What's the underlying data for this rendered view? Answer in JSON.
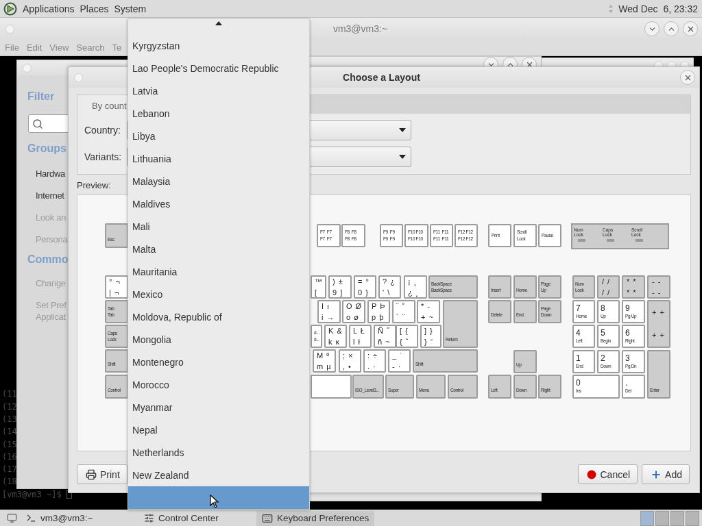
{
  "top_panel": {
    "menus": [
      "Applications",
      "Places",
      "System"
    ],
    "clock": "Wed Dec  6, 23:32"
  },
  "terminal": {
    "title": "vm3@vm3:~",
    "menus": [
      "File",
      "Edit",
      "View",
      "Search",
      "Te"
    ],
    "lines": [
      "(11",
      "(12",
      "(13",
      "(14",
      "(15",
      "(16",
      "(17",
      "(18"
    ],
    "prompt": "[vm3@vm3 ~]$"
  },
  "control_center": {
    "filter_heading": "Filter",
    "groups_heading": "Groups",
    "groups": [
      "Hardwa",
      "Internet",
      "Look an",
      "Persona"
    ],
    "common_heading": "Commo",
    "common": [
      "Change",
      "Set Pref\nApplicat"
    ]
  },
  "dialog": {
    "title": "Choose a Layout",
    "tab": {
      "label": "By count",
      "selected": true
    },
    "country_label": "Country:",
    "variants_label": "Variants:",
    "preview_label": "Preview:",
    "buttons": [
      {
        "kind": "print",
        "label": "Print"
      },
      {
        "kind": "cancel",
        "label": "Cancel"
      },
      {
        "kind": "add",
        "label": "Add"
      }
    ]
  },
  "keyboard": {
    "indicators": [
      {
        "label": "Num\nLock",
        "on": false
      },
      {
        "label": "Caps\nLock",
        "on": false
      },
      {
        "label": "Scroll\nLock",
        "on": false
      }
    ],
    "keys": [
      {
        "kind": "mod",
        "legend": "Esc"
      },
      {
        "kind": "fkey",
        "legend": "F7  F7\nF7  F7"
      },
      {
        "kind": "fkey",
        "legend": "F8  F8\nF8  F8"
      },
      {
        "kind": "fkey",
        "legend": "F9  F9\nF9  F9"
      },
      {
        "kind": "fkey",
        "legend": "F10 F10\nF10 F10"
      },
      {
        "kind": "fkey",
        "legend": "F11  F11\nF11  F11"
      },
      {
        "kind": "fkey",
        "legend": "F12 F12\nF12 F12"
      },
      {
        "kind": "fkey",
        "legend": "Print"
      },
      {
        "kind": "fkey",
        "legend": "Scroll\nLock"
      },
      {
        "kind": "fkey",
        "legend": "Pause"
      },
      {
        "kind": "char",
        "legend": "°  ¬\n|  ¬"
      },
      {
        "kind": "char",
        "legend": "™\n["
      },
      {
        "kind": "char",
        "legend": ")  ±\n9  ]"
      },
      {
        "kind": "char",
        "legend": "=  °\n0  }"
      },
      {
        "kind": "char",
        "legend": "?  ¿\n'  \\"
      },
      {
        "kind": "char",
        "legend": "¡  ¸\n¿  ˛"
      },
      {
        "kind": "mod",
        "legend": "BackSpace\nBackSpace"
      },
      {
        "kind": "mod",
        "legend": "Insert"
      },
      {
        "kind": "mod",
        "legend": "Home"
      },
      {
        "kind": "mod",
        "legend": "Page\nUp"
      },
      {
        "kind": "mod",
        "legend": "Num\nLock"
      },
      {
        "kind": "charmod",
        "legend": "/  /\n/  /"
      },
      {
        "kind": "charmod",
        "legend": "*  *\n*  *"
      },
      {
        "kind": "charmod",
        "legend": "-  -\n-  -"
      },
      {
        "kind": "mod",
        "legend": "Tab\nTab"
      },
      {
        "kind": "char",
        "legend": "I  ı\ni  →"
      },
      {
        "kind": "char",
        "legend": "O  Ø\no  ø"
      },
      {
        "kind": "char",
        "legend": "P  Þ\np  þ"
      },
      {
        "kind": "char",
        "legend": "¨  ˚\n´  ¨"
      },
      {
        "kind": "char",
        "legend": "*  -\n+  ~"
      },
      {
        "kind": "mod",
        "legend": "Return"
      },
      {
        "kind": "mod",
        "legend": "Delete"
      },
      {
        "kind": "mod",
        "legend": "End"
      },
      {
        "kind": "mod",
        "legend": "Page\nDown"
      },
      {
        "kind": "num",
        "legend": "7",
        "sub": "Home"
      },
      {
        "kind": "num",
        "legend": "8",
        "sub": "Up"
      },
      {
        "kind": "num",
        "legend": "9",
        "sub": "Pg Up"
      },
      {
        "kind": "charmod",
        "legend": "+  +\n\n+  +"
      },
      {
        "kind": "mod",
        "legend": "Caps\nLock"
      },
      {
        "kind": "fkey",
        "legend": "d...\nd..."
      },
      {
        "kind": "char",
        "legend": "K  &\nk  ĸ"
      },
      {
        "kind": "char",
        "legend": "L  Ł\nl  ł"
      },
      {
        "kind": "char",
        "legend": "Ñ  ˝\nñ  ~"
      },
      {
        "kind": "char",
        "legend": "[  {\n{  ˆ"
      },
      {
        "kind": "char",
        "legend": "]  }\n}  ˘"
      },
      {
        "kind": "num",
        "legend": "4",
        "sub": "Left"
      },
      {
        "kind": "num",
        "legend": "5",
        "sub": "Begin"
      },
      {
        "kind": "num",
        "legend": "6",
        "sub": "Right"
      },
      {
        "kind": "mod",
        "legend": "Shift"
      },
      {
        "kind": "char",
        "legend": "M  º\nm  µ"
      },
      {
        "kind": "char",
        "legend": ";  ×\n,  •"
      },
      {
        "kind": "char",
        "legend": ":  ÷\n.  ·"
      },
      {
        "kind": "char",
        "legend": "_  ˙\n-  ·"
      },
      {
        "kind": "mod",
        "legend": "Shift"
      },
      {
        "kind": "mod",
        "legend": "Up"
      },
      {
        "kind": "num",
        "legend": "1",
        "sub": "End"
      },
      {
        "kind": "num",
        "legend": "2",
        "sub": "Down"
      },
      {
        "kind": "num",
        "legend": "3",
        "sub": "Pg Dn"
      },
      {
        "kind": "mod",
        "legend": "Control"
      },
      {
        "kind": "blank"
      },
      {
        "kind": "mod",
        "legend": "ISO_Level3..."
      },
      {
        "kind": "mod",
        "legend": "Super"
      },
      {
        "kind": "mod",
        "legend": "Menu"
      },
      {
        "kind": "mod",
        "legend": "Control"
      },
      {
        "kind": "mod",
        "legend": "Left"
      },
      {
        "kind": "mod",
        "legend": "Down"
      },
      {
        "kind": "mod",
        "legend": "Right"
      },
      {
        "kind": "num",
        "legend": "0",
        "sub": "Ins"
      },
      {
        "kind": "num",
        "legend": ".",
        "sub": "Del"
      },
      {
        "kind": "mod",
        "legend": "Enter"
      }
    ]
  },
  "popup": {
    "items": [
      {
        "label": "Kyrgyzstan",
        "selected": false
      },
      {
        "label": "Lao People's Democratic Republic",
        "selected": false
      },
      {
        "label": "Latvia",
        "selected": false
      },
      {
        "label": "Lebanon",
        "selected": false
      },
      {
        "label": "Libya",
        "selected": false
      },
      {
        "label": "Lithuania",
        "selected": false
      },
      {
        "label": "Malaysia",
        "selected": false
      },
      {
        "label": "Maldives",
        "selected": false
      },
      {
        "label": "Mali",
        "selected": false
      },
      {
        "label": "Malta",
        "selected": false
      },
      {
        "label": "Mauritania",
        "selected": false
      },
      {
        "label": "Mexico",
        "selected": false
      },
      {
        "label": "Moldova, Republic of",
        "selected": false
      },
      {
        "label": "Mongolia",
        "selected": false
      },
      {
        "label": "Montenegro",
        "selected": false
      },
      {
        "label": "Morocco",
        "selected": false
      },
      {
        "label": "Myanmar",
        "selected": false
      },
      {
        "label": "Nepal",
        "selected": false
      },
      {
        "label": "Netherlands",
        "selected": false
      },
      {
        "label": "New Zealand",
        "selected": false
      },
      {
        "selected": true
      }
    ]
  },
  "taskbar": {
    "tasks": [
      {
        "kind": "terminal",
        "label": "vm3@vm3:~",
        "selected": false
      },
      {
        "kind": "control",
        "label": "Control Center",
        "selected": false
      },
      {
        "kind": "keyboard",
        "label": "Keyboard Preferences",
        "selected": true
      }
    ]
  }
}
